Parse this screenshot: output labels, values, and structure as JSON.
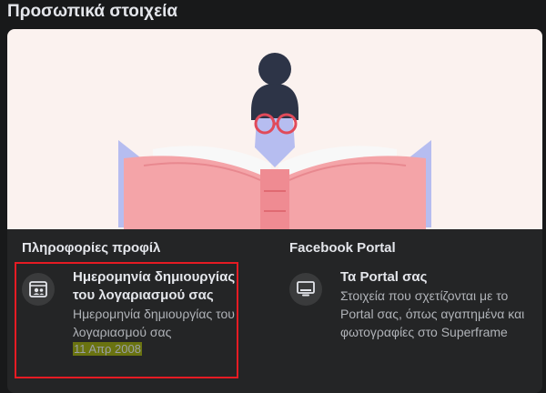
{
  "page": {
    "title": "Προσωπικά στοιχεία"
  },
  "profile_section": {
    "title": "Πληροφορίες προφίλ",
    "item": {
      "icon": "profile-card-icon",
      "title": "Ημερομηνία δημιουργίας του λογαριασμού σας",
      "subtitle": "Ημερομηνία δημιουργίας του λογαριασμού σας",
      "date": "11 Απρ 2008"
    }
  },
  "portal_section": {
    "title": "Facebook Portal",
    "item": {
      "icon": "portal-display-icon",
      "title": "Τα Portal σας",
      "subtitle": "Στοιχεία που σχετίζονται με το Portal σας, όπως αγαπημένα και φωτογραφίες στο Superframe"
    }
  },
  "colors": {
    "background": "#18191a",
    "card": "#242526",
    "hero_background": "#fbf2ef",
    "highlight_border": "#e51b23"
  }
}
